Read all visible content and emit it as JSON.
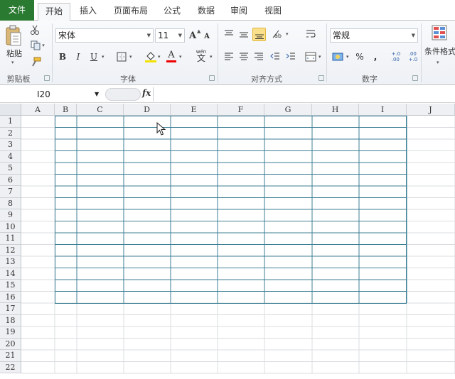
{
  "tabs": [
    "文件",
    "开始",
    "插入",
    "页面布局",
    "公式",
    "数据",
    "审阅",
    "视图"
  ],
  "ribbon": {
    "clipboard": {
      "paste_label": "粘贴",
      "group_label": "剪贴板"
    },
    "font": {
      "font_name": "宋体",
      "font_size": "11",
      "bold": "B",
      "italic": "I",
      "underline": "U",
      "grow": "A",
      "shrink": "A",
      "font_color": "A",
      "phonetic": "文",
      "phonetic_top": "wén",
      "group_label": "字体"
    },
    "alignment": {
      "group_label": "对齐方式"
    },
    "number": {
      "format": "常规",
      "percent": "%",
      "comma": ",",
      "inc_decimal": "+.0\n.00",
      "dec_decimal": ".00\n+.0",
      "group_label": "数字"
    },
    "styles": {
      "conditional_label": "条件格式"
    }
  },
  "formula_bar": {
    "cell_ref": "I20",
    "fx": "fx",
    "value": ""
  },
  "grid": {
    "columns": [
      "A",
      "B",
      "C",
      "D",
      "E",
      "F",
      "G",
      "H",
      "I",
      "J"
    ],
    "rows": [
      "1",
      "2",
      "3",
      "4",
      "5",
      "6",
      "7",
      "8",
      "9",
      "10",
      "11",
      "12",
      "13",
      "14",
      "15",
      "16",
      "17",
      "18",
      "19",
      "20",
      "21",
      "22"
    ]
  },
  "colors": {
    "file_tab": "#2b7a32",
    "table_border": "#3d7f95",
    "selected_align": "#fbe08b"
  }
}
